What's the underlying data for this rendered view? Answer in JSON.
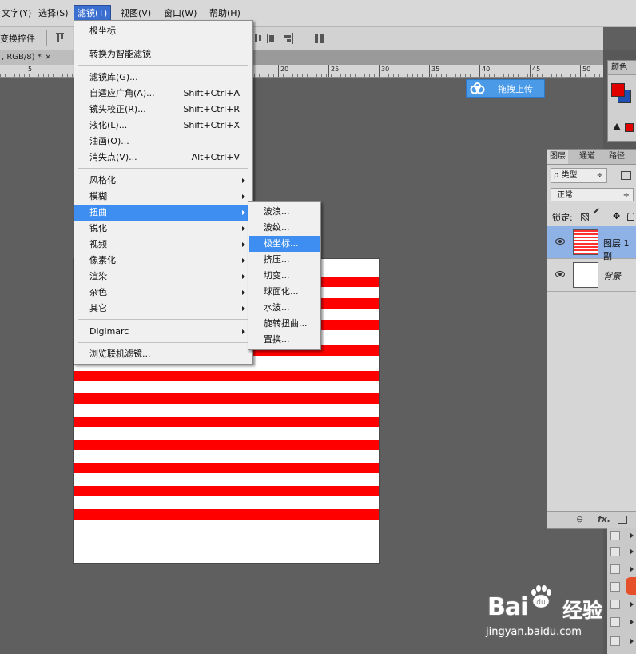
{
  "menubar": {
    "items": [
      {
        "label": "文字(Y)"
      },
      {
        "label": "选择(S)"
      },
      {
        "label": "滤镜(T)",
        "active": true
      },
      {
        "label": "视图(V)"
      },
      {
        "label": "窗口(W)"
      },
      {
        "label": "帮助(H)"
      }
    ]
  },
  "options_bar": {
    "label": "变换控件"
  },
  "doc_tab": {
    "title": ", RGB/8) *",
    "close": "×"
  },
  "ruler": {
    "numbers": [
      "5",
      "20",
      "25",
      "30",
      "35",
      "40",
      "45",
      "50"
    ]
  },
  "filter_menu": {
    "items": [
      {
        "label": "极坐标"
      },
      {
        "label": "转换为智能滤镜"
      },
      {
        "label": "滤镜库(G)..."
      },
      {
        "label": "自适应广角(A)...",
        "shortcut": "Shift+Ctrl+A"
      },
      {
        "label": "镜头校正(R)...",
        "shortcut": "Shift+Ctrl+R"
      },
      {
        "label": "液化(L)...",
        "shortcut": "Shift+Ctrl+X"
      },
      {
        "label": "油画(O)..."
      },
      {
        "label": "消失点(V)...",
        "shortcut": "Alt+Ctrl+V"
      },
      {
        "label": "风格化"
      },
      {
        "label": "模糊"
      },
      {
        "label": "扭曲"
      },
      {
        "label": "锐化"
      },
      {
        "label": "视频"
      },
      {
        "label": "像素化"
      },
      {
        "label": "渲染"
      },
      {
        "label": "杂色"
      },
      {
        "label": "其它"
      },
      {
        "label": "Digimarc"
      },
      {
        "label": "浏览联机滤镜..."
      }
    ]
  },
  "distort_submenu": {
    "items": [
      {
        "label": "波浪..."
      },
      {
        "label": "波纹..."
      },
      {
        "label": "极坐标..."
      },
      {
        "label": "挤压..."
      },
      {
        "label": "切变..."
      },
      {
        "label": "球面化..."
      },
      {
        "label": "水波..."
      },
      {
        "label": "旋转扭曲..."
      },
      {
        "label": "置换..."
      }
    ]
  },
  "upload_badge": {
    "label": "拖拽上传"
  },
  "color_panel": {
    "tab": "颜色"
  },
  "layers_panel": {
    "tabs": [
      "图层",
      "通道",
      "路径"
    ],
    "kind_filter": "ρ 类型",
    "blend_mode": "正常",
    "lock_label": "锁定:",
    "layers": [
      {
        "name": "图层 1 副",
        "selected": true
      },
      {
        "name": "背景",
        "selected": false
      }
    ],
    "footer_fx": "fx."
  },
  "watermark": {
    "brand": "Bai",
    "brand2": "经验",
    "url": "jingyan.baidu.com",
    "paw_text": "du"
  },
  "colors": {
    "accent": "#3d8ef0",
    "stripe": "#ff0000",
    "fg_swatch": "#e00000",
    "bg_swatch": "#1f4fb0"
  }
}
